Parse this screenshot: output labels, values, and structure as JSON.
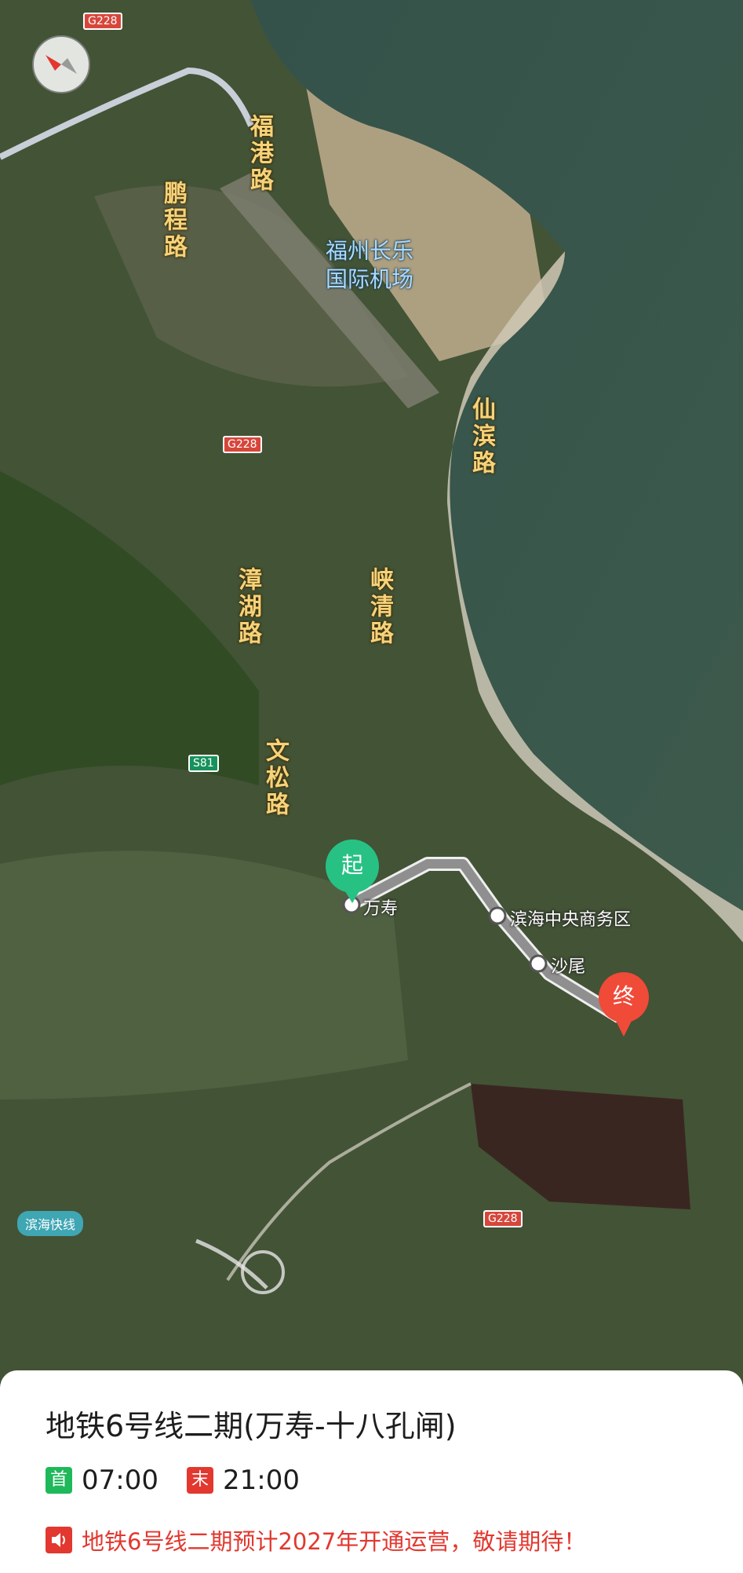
{
  "map": {
    "shields": {
      "g228_top": "G228",
      "g228_mid": "G228",
      "g228_bottom": "G228",
      "s81": "S81"
    },
    "roads": {
      "fugang": "福港路",
      "pengcheng": "鹏程路",
      "xianbin": "仙滨路",
      "zhanghu": "漳湖路",
      "xiaqing": "峡清路",
      "wensong": "文松路"
    },
    "airport": {
      "line1": "福州长乐",
      "line2": "国际机场"
    },
    "expressway": "滨海快线",
    "start_marker": "起",
    "end_marker": "终",
    "stations": {
      "wanshou": "万寿",
      "cbd": "滨海中央商务区",
      "shawei": "沙尾"
    },
    "colors": {
      "start": "#27c184",
      "end": "#f04a38",
      "route": "#8f8f8f"
    }
  },
  "panel": {
    "title": "地铁6号线二期(万寿-十八孔闸)",
    "first_tag": "首",
    "first_time": "07:00",
    "last_tag": "末",
    "last_time": "21:00",
    "notice": "地铁6号线二期预计2027年开通运营，敬请期待！"
  }
}
